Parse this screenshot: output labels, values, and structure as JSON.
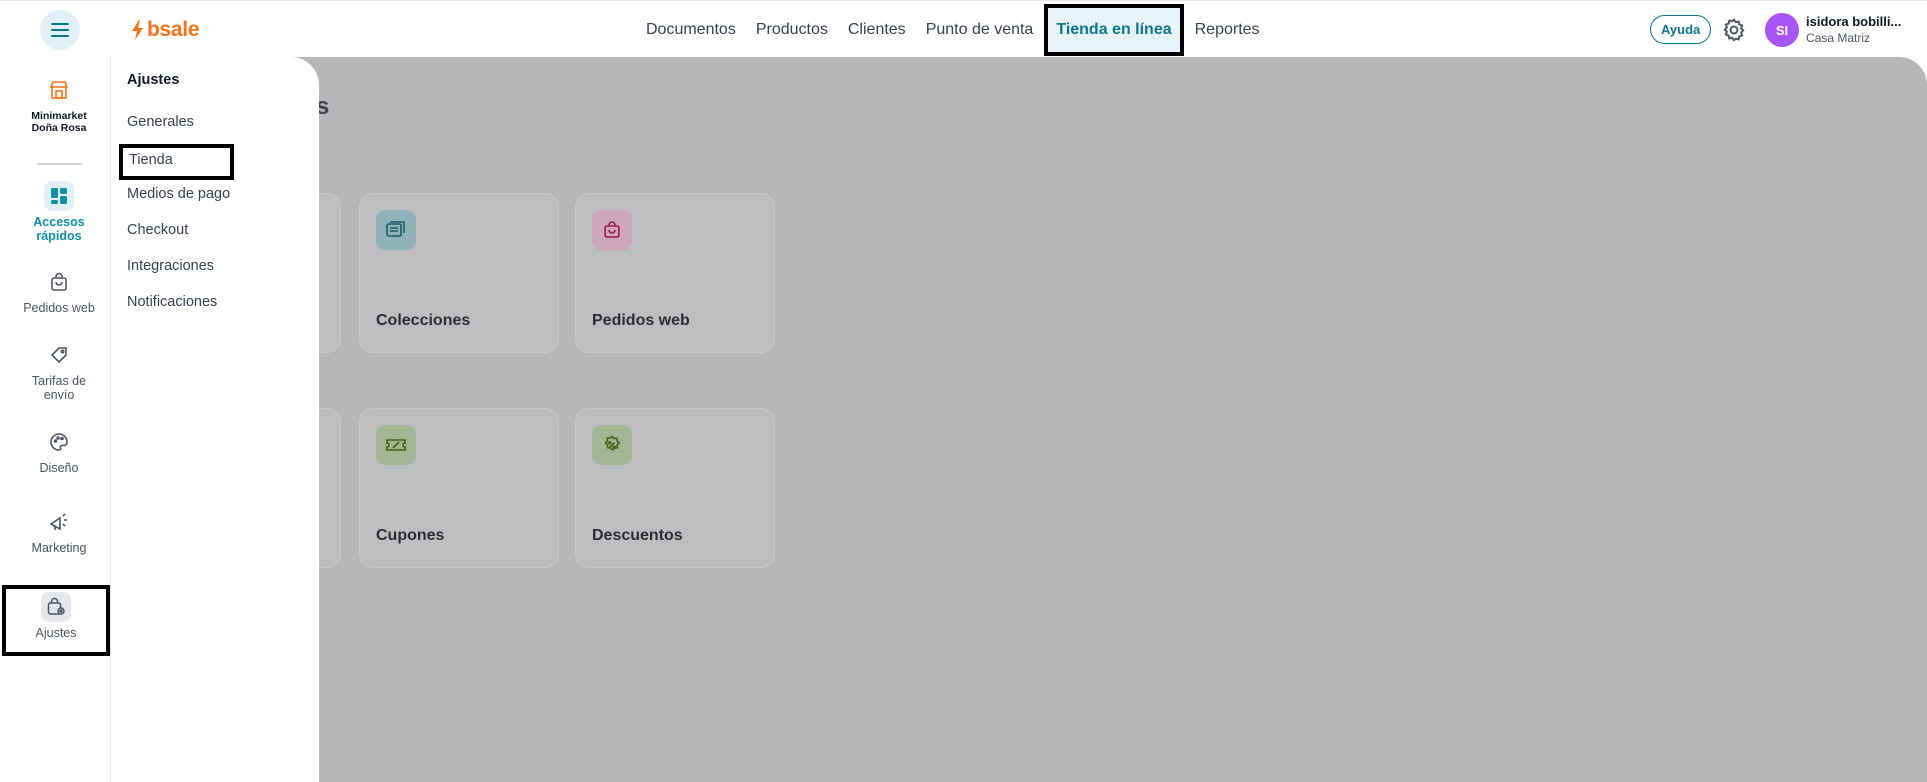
{
  "header": {
    "brand": "bsale",
    "nav": [
      {
        "label": "Documentos"
      },
      {
        "label": "Productos"
      },
      {
        "label": "Clientes"
      },
      {
        "label": "Punto de venta"
      },
      {
        "label": "Tienda en línea",
        "active": true
      },
      {
        "label": "Reportes"
      }
    ],
    "help_label": "Ayuda",
    "avatar_initials": "SI",
    "user_name": "isidora bobilli...",
    "branch": "Casa Matriz"
  },
  "sidebar": {
    "store_name_line1": "Minimarket",
    "store_name_line2": "Doña Rosa",
    "items": [
      {
        "label_line1": "Accesos",
        "label_line2": "rápidos",
        "icon": "dashboard-icon",
        "active": true
      },
      {
        "label_line1": "Pedidos web",
        "label_line2": "",
        "icon": "bag-icon"
      },
      {
        "label_line1": "Tarifas de",
        "label_line2": "envío",
        "icon": "tag-icon"
      },
      {
        "label_line1": "Diseño",
        "label_line2": "",
        "icon": "palette-icon"
      },
      {
        "label_line1": "Marketing",
        "label_line2": "",
        "icon": "megaphone-icon"
      },
      {
        "label_line1": "Ajustes",
        "label_line2": "",
        "icon": "settings-bag-icon"
      }
    ]
  },
  "submenu": {
    "title": "Ajustes",
    "items": [
      "Generales",
      "Tienda",
      "Medios de pago",
      "Checkout",
      "Integraciones",
      "Notificaciones"
    ]
  },
  "background": {
    "heading_fragment": "s",
    "cards": [
      {
        "label": "Colecciones",
        "icon": "collections-icon"
      },
      {
        "label": "Pedidos web",
        "icon": "bag-icon"
      },
      {
        "label": "Cupones",
        "icon": "coupon-icon"
      },
      {
        "label": "Descuentos",
        "icon": "discount-icon"
      }
    ]
  },
  "colors": {
    "accent": "#0e7490",
    "brand": "#f97316",
    "avatar": "#a855f7"
  }
}
